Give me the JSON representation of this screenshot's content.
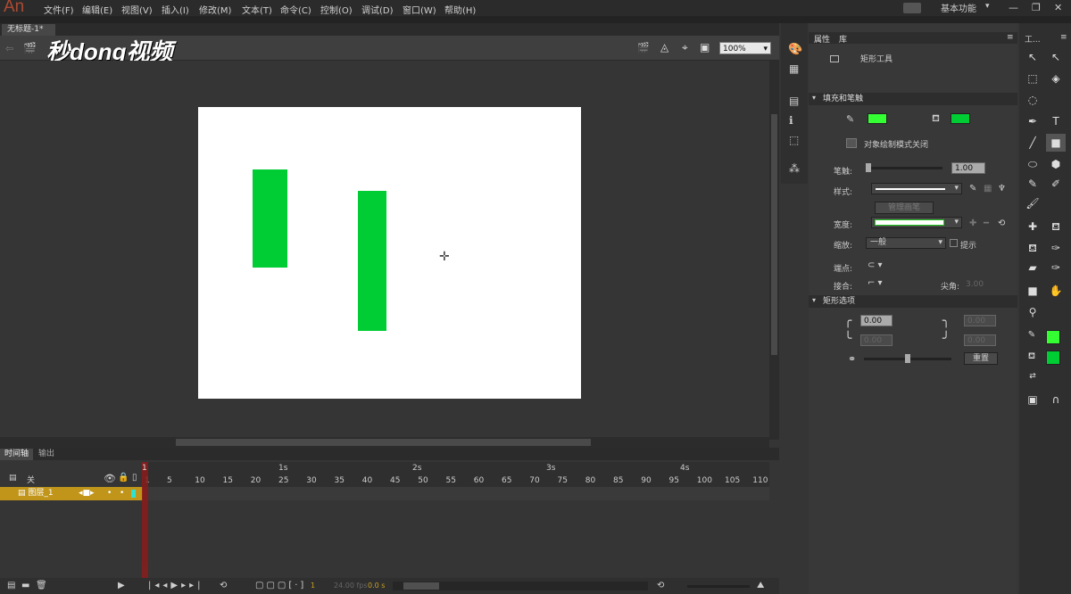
{
  "app": {
    "logo": "An"
  },
  "menu": [
    "文件(F)",
    "编辑(E)",
    "视图(V)",
    "插入(I)",
    "修改(M)",
    "文本(T)",
    "命令(C)",
    "控制(O)",
    "调试(D)",
    "窗口(W)",
    "帮助(H)"
  ],
  "workspace": "基本功能",
  "window_controls": {
    "min": "—",
    "max": "❐",
    "close": "✕"
  },
  "doc_tab": "无标题-1*",
  "doc_tab_close": "×",
  "watermark": "秒dong视频",
  "zoom": "100%",
  "stage_color": "#ffffff",
  "shape_color": "#00cc33",
  "timeline": {
    "tabs": [
      "时间轴",
      "输出"
    ],
    "layer_name": "图层_1",
    "ruler_seconds": [
      "1s",
      "2s",
      "3s",
      "4s"
    ],
    "ruler_frames": [
      "1",
      "5",
      "10",
      "15",
      "20",
      "25",
      "30",
      "35",
      "40",
      "45",
      "50",
      "55",
      "60",
      "65",
      "70",
      "75",
      "80",
      "85",
      "90",
      "95",
      "100",
      "105",
      "110"
    ],
    "current_frame": "1",
    "fps": "24.00 fps",
    "time": "0.0 s",
    "parent_label": "关"
  },
  "properties": {
    "tabs": [
      "属性",
      "库"
    ],
    "tool_name": "矩形工具",
    "fill_stroke_header": "填充和笔触",
    "object_draw": "对象绘制模式关闭",
    "stroke_label": "笔触:",
    "stroke_value": "1.00",
    "style_label": "样式:",
    "manage_width": "管理画笔",
    "width_label": "宽度:",
    "scale_label": "缩放:",
    "scale_value": "一般",
    "hint_label": "提示",
    "cap_label": "端点:",
    "join_label": "接合:",
    "miter_label": "尖角:",
    "miter_value": "3.00",
    "rect_header": "矩形选项",
    "corner_value": "0.00",
    "reset_button": "重置",
    "stroke_color": "#33ff33",
    "fill_color": "#00cc33"
  },
  "tools_header": "工..."
}
